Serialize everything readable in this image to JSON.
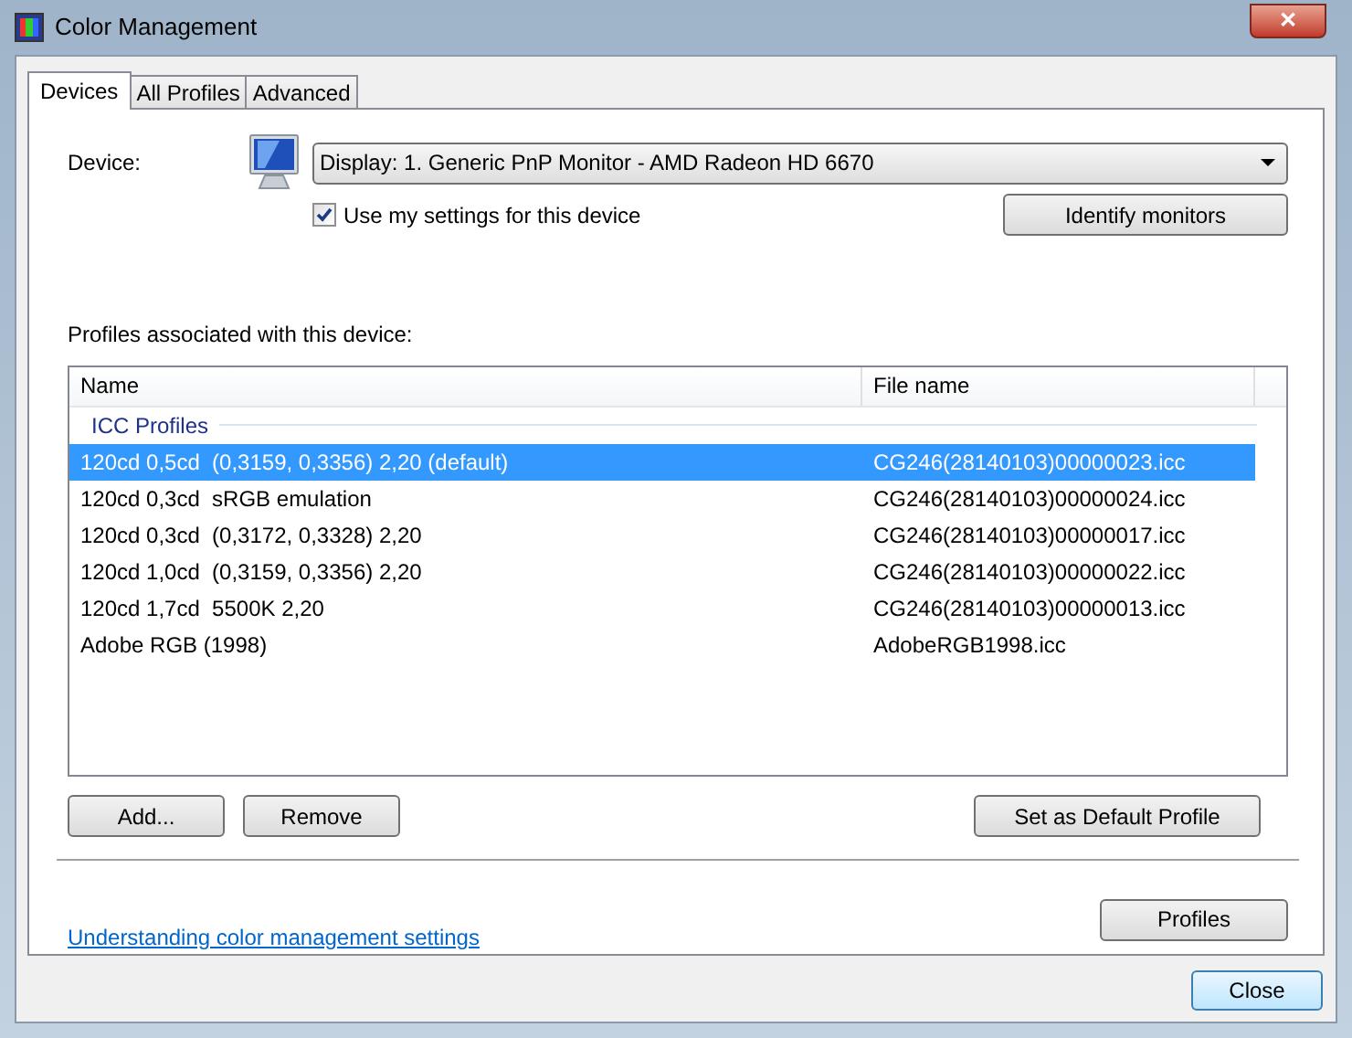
{
  "window": {
    "title": "Color Management",
    "close_glyph": "✕"
  },
  "tabs": [
    {
      "label": "Devices",
      "selected": true
    },
    {
      "label": "All Profiles",
      "selected": false
    },
    {
      "label": "Advanced",
      "selected": false
    }
  ],
  "device": {
    "label": "Device:",
    "value": "Display: 1. Generic PnP Monitor - AMD Radeon HD 6670"
  },
  "use_my_settings": {
    "label": "Use my settings for this device",
    "checked": true
  },
  "identify_button": "Identify monitors",
  "profiles_label": "Profiles associated with this device:",
  "table": {
    "columns": [
      "Name",
      "File name"
    ],
    "group": "ICC Profiles",
    "rows": [
      {
        "name": "120cd 0,5cd  (0,3159, 0,3356) 2,20 (default)",
        "file": "CG246(28140103)00000023.icc",
        "selected": true
      },
      {
        "name": "120cd 0,3cd  sRGB emulation",
        "file": "CG246(28140103)00000024.icc",
        "selected": false
      },
      {
        "name": "120cd 0,3cd  (0,3172, 0,3328) 2,20",
        "file": "CG246(28140103)00000017.icc",
        "selected": false
      },
      {
        "name": "120cd 1,0cd  (0,3159, 0,3356) 2,20",
        "file": "CG246(28140103)00000022.icc",
        "selected": false
      },
      {
        "name": "120cd 1,7cd  5500K 2,20",
        "file": "CG246(28140103)00000013.icc",
        "selected": false
      },
      {
        "name": "Adobe RGB (1998)",
        "file": "AdobeRGB1998.icc",
        "selected": false
      }
    ]
  },
  "list_buttons": [
    "Add...",
    "Remove",
    "Set as Default Profile"
  ],
  "link": "Understanding color management settings",
  "profiles_button": "Profiles",
  "close_button": "Close"
}
